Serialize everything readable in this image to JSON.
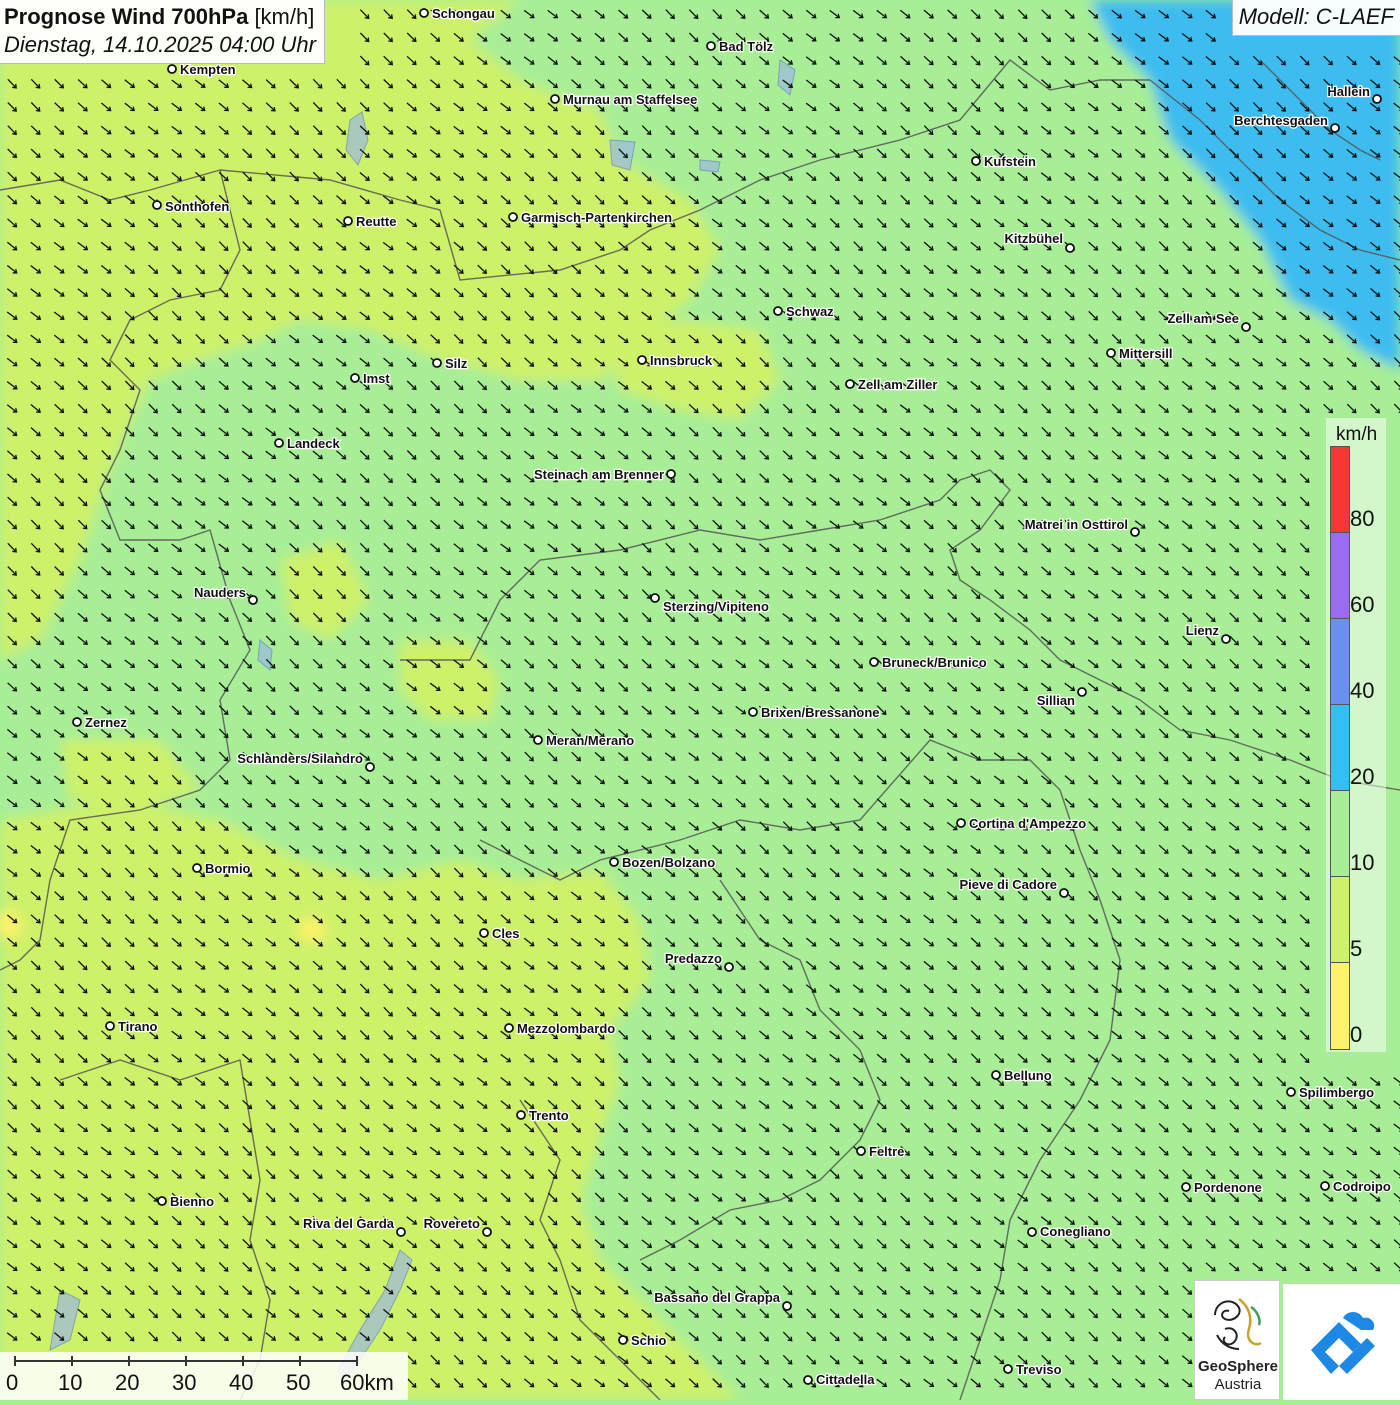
{
  "header": {
    "title": "Prognose Wind 700hPa",
    "unit": "[km/h]",
    "datetime": "Dienstag, 14.10.2025 04:00 Uhr"
  },
  "model": "Modell: C-LAEF",
  "legend": {
    "unit": "km/h",
    "ticks": [
      "80",
      "60",
      "40",
      "20",
      "10",
      "5",
      "0"
    ],
    "colors": [
      "#f73636",
      "#9b6cf2",
      "#6a8fef",
      "#33bff1",
      "#a7ee97",
      "#cef16b",
      "#fdf26b"
    ]
  },
  "scale": {
    "labels": [
      "0",
      "10",
      "20",
      "30",
      "40",
      "50",
      "60km"
    ]
  },
  "logos": {
    "geosphere_line1": "GeoSphere",
    "geosphere_line2": "Austria"
  },
  "colors": {
    "wind_lt_5": "#fdf26b",
    "wind_5_10": "#cef16b",
    "wind_10_20": "#a7ee97",
    "wind_20_40": "#33bff1",
    "arrow": "#111111",
    "border": "#555555"
  },
  "wind_direction": "from northwest",
  "cities": [
    {
      "name": "Schongau"
    },
    {
      "name": "Bad Tölz"
    },
    {
      "name": "Kempten"
    },
    {
      "name": "Murnau am Staffelsee"
    },
    {
      "name": "Hallein"
    },
    {
      "name": "Berchtesgaden"
    },
    {
      "name": "Kufstein"
    },
    {
      "name": "Sonthofen"
    },
    {
      "name": "Reutte"
    },
    {
      "name": "Garmisch-Partenkirchen"
    },
    {
      "name": "Kitzbühel"
    },
    {
      "name": "Schwaz"
    },
    {
      "name": "Zell am See"
    },
    {
      "name": "Innsbruck"
    },
    {
      "name": "Mittersill"
    },
    {
      "name": "Silz"
    },
    {
      "name": "Imst"
    },
    {
      "name": "Zell am Ziller"
    },
    {
      "name": "Landeck"
    },
    {
      "name": "Steinach am Brenner"
    },
    {
      "name": "Matrei in Osttirol"
    },
    {
      "name": "Nauders"
    },
    {
      "name": "Sterzing/Vipiteno"
    },
    {
      "name": "Lienz"
    },
    {
      "name": "Bruneck/Brunico"
    },
    {
      "name": "Sillian"
    },
    {
      "name": "Brixen/Bressanone"
    },
    {
      "name": "Zernez"
    },
    {
      "name": "Meran/Merano"
    },
    {
      "name": "Schlanders/Silandro"
    },
    {
      "name": "Cortina d'Ampezzo"
    },
    {
      "name": "Bozen/Bolzano"
    },
    {
      "name": "Pieve di Cadore"
    },
    {
      "name": "Bormio"
    },
    {
      "name": "Cles"
    },
    {
      "name": "Predazzo"
    },
    {
      "name": "Tirano"
    },
    {
      "name": "Mezzolombardo"
    },
    {
      "name": "Belluno"
    },
    {
      "name": "Spilimbergo"
    },
    {
      "name": "Trento"
    },
    {
      "name": "Feltre"
    },
    {
      "name": "Pordenone"
    },
    {
      "name": "Codroipo"
    },
    {
      "name": "Bienno"
    },
    {
      "name": "Riva del Garda"
    },
    {
      "name": "Rovereto"
    },
    {
      "name": "Conegliano"
    },
    {
      "name": "Bassano del Grappa"
    },
    {
      "name": "Schio"
    },
    {
      "name": "Treviso"
    },
    {
      "name": "Cittadella"
    }
  ]
}
